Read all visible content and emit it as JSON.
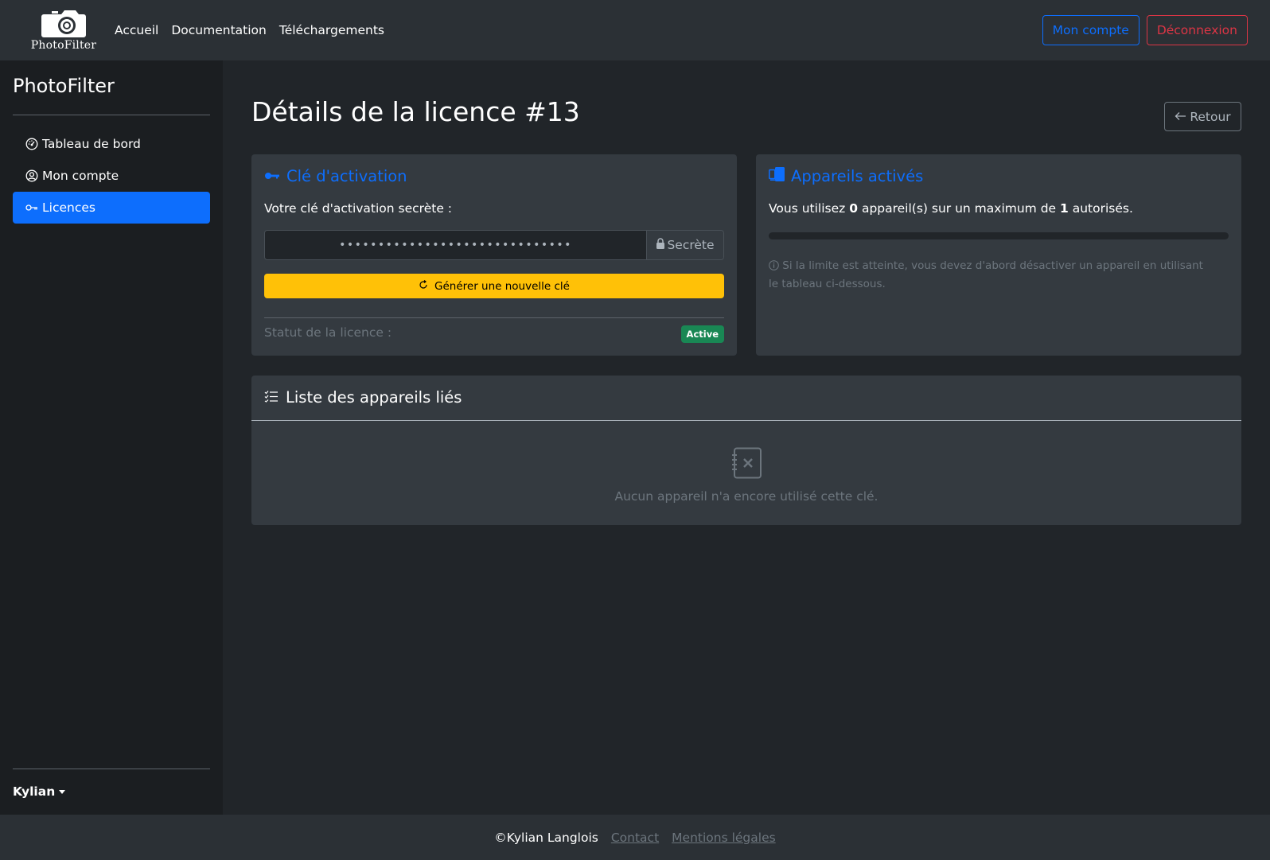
{
  "brand": {
    "name": "PhotoFilter",
    "icon": "camera-icon"
  },
  "nav": {
    "links": [
      "Accueil",
      "Documentation",
      "Téléchargements"
    ]
  },
  "actions": {
    "account": "Mon compte",
    "logout": "Déconnexion"
  },
  "sidebar": {
    "title": "PhotoFilter",
    "items": [
      {
        "label": "Tableau de bord",
        "icon": "speedometer-icon"
      },
      {
        "label": "Mon compte",
        "icon": "person-circle-icon"
      },
      {
        "label": "Licences",
        "icon": "key-icon",
        "active": true
      }
    ],
    "user": "Kylian"
  },
  "page": {
    "title": "Détails de la licence #13",
    "back": "Retour"
  },
  "activation": {
    "title": "Clé d'activation",
    "label": "Votre clé d'activation secrète :",
    "masked": "••••••••••••••••••••••••••••••",
    "addon": "Secrète",
    "generate": "Générer une nouvelle clé",
    "status_label": "Statut de la licence :",
    "status_value": "Active"
  },
  "devices": {
    "title": "Appareils activés",
    "text_pre": "Vous utilisez ",
    "used": "0",
    "text_mid": " appareil(s) sur un maximum de ",
    "max": "1",
    "text_post": " autorisés.",
    "progress": 0,
    "info": "Si la limite est atteinte, vous devez d'abord désactiver un appareil en utilisant le tableau ci-dessous."
  },
  "list": {
    "title": "Liste des appareils liés",
    "empty": "Aucun appareil n'a encore utilisé cette clé."
  },
  "footer": {
    "copyright": "©Kylian Langlois",
    "contact": "Contact",
    "legal": "Mentions légales"
  },
  "colors": {
    "primary": "#0d6efd",
    "warning": "#ffc107",
    "danger": "#dc3545",
    "success": "#198754"
  }
}
